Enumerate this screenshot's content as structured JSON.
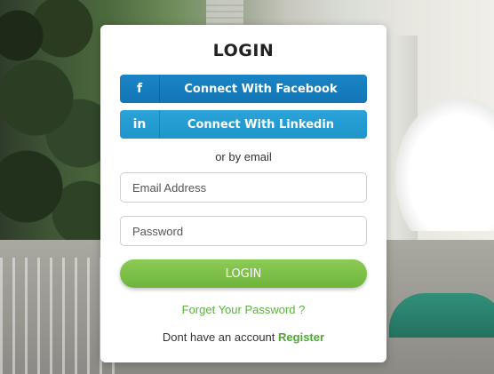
{
  "login": {
    "title": "LOGIN",
    "facebook": {
      "icon": "f",
      "icon_name": "facebook-icon",
      "label": "Connect With Facebook",
      "color": "#1a7fc0"
    },
    "linkedin": {
      "icon": "in",
      "icon_name": "linkedin-icon",
      "label": "Connect With Linkedin",
      "color": "#239dd2"
    },
    "separator": "or by email",
    "email_placeholder": "Email Address",
    "password_placeholder": "Password",
    "submit_label": "LOGIN",
    "submit_color": "#7cc04a",
    "forgot_label": "Forget Your Password ?",
    "register_prompt": "Dont have an account",
    "register_label": "Register",
    "accent_color": "#5cb140"
  }
}
